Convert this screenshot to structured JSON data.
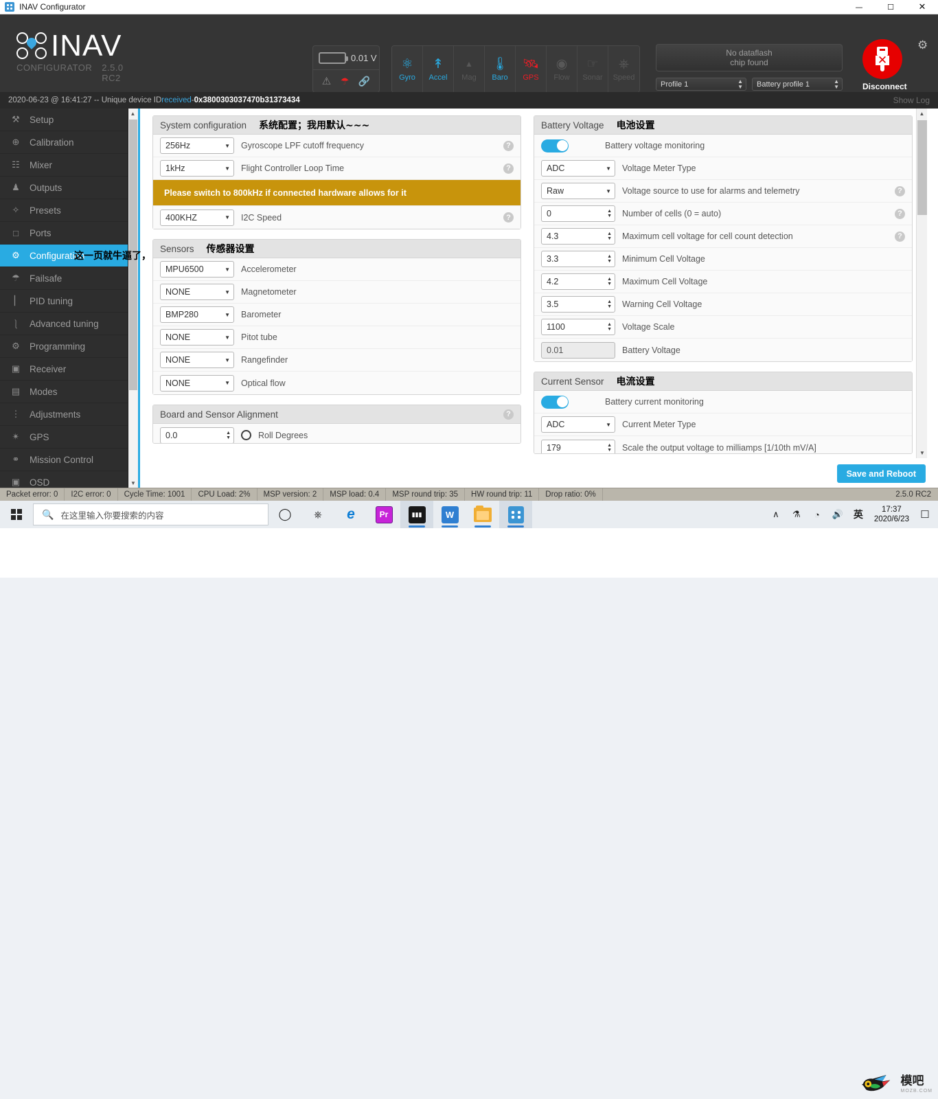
{
  "window": {
    "title": "INAV Configurator",
    "minimize": "—",
    "maximize": "▢",
    "close": "✕"
  },
  "header": {
    "logo_text": "INAV",
    "logo_sub_left": "CONFIGURATOR",
    "logo_sub_right": "2.5.0 RC2",
    "battery_voltage": "0.01 V",
    "status_icons": [
      "warning-icon",
      "parachute-icon",
      "link-icon"
    ],
    "sensors": [
      {
        "label": "Gyro",
        "state": "on"
      },
      {
        "label": "Accel",
        "state": "on"
      },
      {
        "label": "Mag",
        "state": "off"
      },
      {
        "label": "Baro",
        "state": "on"
      },
      {
        "label": "GPS",
        "state": "err"
      },
      {
        "label": "Flow",
        "state": "off"
      },
      {
        "label": "Sonar",
        "state": "off"
      },
      {
        "label": "Speed",
        "state": "off"
      }
    ],
    "dataflash_line1": "No dataflash",
    "dataflash_line2": "chip found",
    "profile": "Profile 1",
    "battery_profile": "Battery profile 1",
    "disconnect_label": "Disconnect"
  },
  "logstrip": {
    "timestamp": "2020-06-23 @ 16:41:27 -- Unique device ID ",
    "received": "received",
    "separator": " - ",
    "device_id": "0x3800303037470b31373434",
    "show_log": "Show Log"
  },
  "sidebar": {
    "items": [
      {
        "label": "Setup",
        "icon": "wrench-icon",
        "glyph": "⚒",
        "active": false
      },
      {
        "label": "Calibration",
        "icon": "crosshair-icon",
        "glyph": "⊕",
        "active": false
      },
      {
        "label": "Mixer",
        "icon": "mixer-icon",
        "glyph": "☷",
        "active": false
      },
      {
        "label": "Outputs",
        "icon": "motor-icon",
        "glyph": "♟",
        "active": false
      },
      {
        "label": "Presets",
        "icon": "wand-icon",
        "glyph": "✧",
        "active": false
      },
      {
        "label": "Ports",
        "icon": "plug-icon",
        "glyph": "⑁",
        "active": false
      },
      {
        "label": "Configuration",
        "icon": "gear-icon",
        "glyph": "⚙",
        "active": true
      },
      {
        "label": "Failsafe",
        "icon": "parachute-icon",
        "glyph": "☂",
        "active": false
      },
      {
        "label": "PID tuning",
        "icon": "sitemap-icon",
        "glyph": "⑂",
        "active": false
      },
      {
        "label": "Advanced tuning",
        "icon": "nodes-icon",
        "glyph": "⑂",
        "active": false
      },
      {
        "label": "Programming",
        "icon": "gear-icon",
        "glyph": "⚙",
        "active": false
      },
      {
        "label": "Receiver",
        "icon": "transmitter-icon",
        "glyph": "⌨",
        "active": false
      },
      {
        "label": "Modes",
        "icon": "modes-icon",
        "glyph": "☰",
        "active": false
      },
      {
        "label": "Adjustments",
        "icon": "sliders-icon",
        "glyph": "≡",
        "active": false
      },
      {
        "label": "GPS",
        "icon": "satellite-icon",
        "glyph": "✴",
        "active": false
      },
      {
        "label": "Mission Control",
        "icon": "map-pin-icon",
        "glyph": "⚑",
        "active": false
      },
      {
        "label": "OSD",
        "icon": "osd-icon",
        "glyph": "▣",
        "active": false
      }
    ]
  },
  "annotations": {
    "sidebar_overlay": "这一页就牛逼了，",
    "system_config": "系统配置；我用默认~~~",
    "sensors": "传感器设置",
    "battery": "电池设置",
    "current": "电流设置"
  },
  "system_configuration": {
    "title": "System configuration",
    "rows": [
      {
        "type": "select",
        "value": "256Hz",
        "label": "Gyroscope LPF cutoff frequency",
        "help": true
      },
      {
        "type": "select",
        "value": "1kHz",
        "label": "Flight Controller Loop Time",
        "help": true
      },
      {
        "type": "select",
        "value": "400KHZ",
        "label": "I2C Speed",
        "help": true
      }
    ],
    "warning": "Please switch to 800kHz if connected hardware allows for it"
  },
  "sensors_panel": {
    "title": "Sensors",
    "rows": [
      {
        "value": "MPU6500",
        "label": "Accelerometer"
      },
      {
        "value": "NONE",
        "label": "Magnetometer"
      },
      {
        "value": "BMP280",
        "label": "Barometer"
      },
      {
        "value": "NONE",
        "label": "Pitot tube"
      },
      {
        "value": "NONE",
        "label": "Rangefinder"
      },
      {
        "value": "NONE",
        "label": "Optical flow"
      }
    ]
  },
  "alignment_panel": {
    "title": "Board and Sensor Alignment",
    "row": {
      "value": "0.0",
      "label": "Roll Degrees"
    }
  },
  "battery_voltage_panel": {
    "title": "Battery Voltage",
    "toggle_label": "Battery voltage monitoring",
    "toggle_on": true,
    "rows": [
      {
        "type": "select",
        "value": "ADC",
        "label": "Voltage Meter Type",
        "help": false
      },
      {
        "type": "select",
        "value": "Raw",
        "label": "Voltage source to use for alarms and telemetry",
        "help": true
      },
      {
        "type": "number",
        "value": "0",
        "label": "Number of cells (0 = auto)",
        "help": true
      },
      {
        "type": "number",
        "value": "4.3",
        "label": "Maximum cell voltage for cell count detection",
        "help": true
      },
      {
        "type": "number",
        "value": "3.3",
        "label": "Minimum Cell Voltage",
        "help": false
      },
      {
        "type": "number",
        "value": "4.2",
        "label": "Maximum Cell Voltage",
        "help": false
      },
      {
        "type": "number",
        "value": "3.5",
        "label": "Warning Cell Voltage",
        "help": false
      },
      {
        "type": "number",
        "value": "1100",
        "label": "Voltage Scale",
        "help": false
      },
      {
        "type": "readonly",
        "value": "0.01",
        "label": "Battery Voltage",
        "help": false
      }
    ]
  },
  "current_sensor_panel": {
    "title": "Current Sensor",
    "toggle_label": "Battery current monitoring",
    "toggle_on": true,
    "rows": [
      {
        "type": "select",
        "value": "ADC",
        "label": "Current Meter Type",
        "help": false
      },
      {
        "type": "number",
        "value": "179",
        "label": "Scale the output voltage to milliamps [1/10th mV/A]",
        "help": false
      }
    ]
  },
  "footer": {
    "save_label": "Save and Reboot"
  },
  "statusbar": {
    "cells": [
      "Packet error: 0",
      "I2C error: 0",
      "Cycle Time: 1001",
      "CPU Load: 2%",
      "MSP version: 2",
      "MSP load: 0.4",
      "MSP round trip: 35",
      "HW round trip: 11",
      "Drop ratio: 0%"
    ],
    "version": "2.5.0 RC2"
  },
  "taskbar": {
    "search_placeholder": "在这里输入你要搜索的内容",
    "icons": [
      {
        "name": "cortana-icon",
        "glyph": "◯",
        "color": "#1f1f1f",
        "running": false
      },
      {
        "name": "task-view-icon",
        "glyph": "⌸",
        "color": "#1f1f1f",
        "running": false
      },
      {
        "name": "edge-icon",
        "glyph": "e",
        "color": "#0f7fd6",
        "running": false
      },
      {
        "name": "premiere-icon",
        "glyph": "Pr",
        "color": "#ffffff",
        "running": false
      },
      {
        "name": "terminal-icon",
        "glyph": "▀",
        "color": "#ffffff",
        "running": true
      },
      {
        "name": "wps-icon",
        "glyph": "W",
        "color": "#ffffff",
        "running": true
      },
      {
        "name": "explorer-icon",
        "glyph": "▤",
        "color": "#f0ae34",
        "running": true
      },
      {
        "name": "inav-icon",
        "glyph": "⌘",
        "color": "#ffffff",
        "running": true
      }
    ],
    "tray": {
      "chevron": "∧",
      "plug": "plug-icon",
      "wifi": "wifi-icon",
      "volume": "🔊",
      "ime": "英",
      "time": "17:37",
      "date": "2020/6/23",
      "notification": "▭"
    }
  },
  "watermark": {
    "cn": "模吧",
    "en": "MOZB.COM"
  },
  "colors": {
    "accent": "#29abe2",
    "warning": "#c8940c",
    "danger": "#e60000",
    "header_bg": "#353535",
    "sidebar_bg": "#2e2e2e",
    "statusbar_bg": "#bab6ab"
  }
}
